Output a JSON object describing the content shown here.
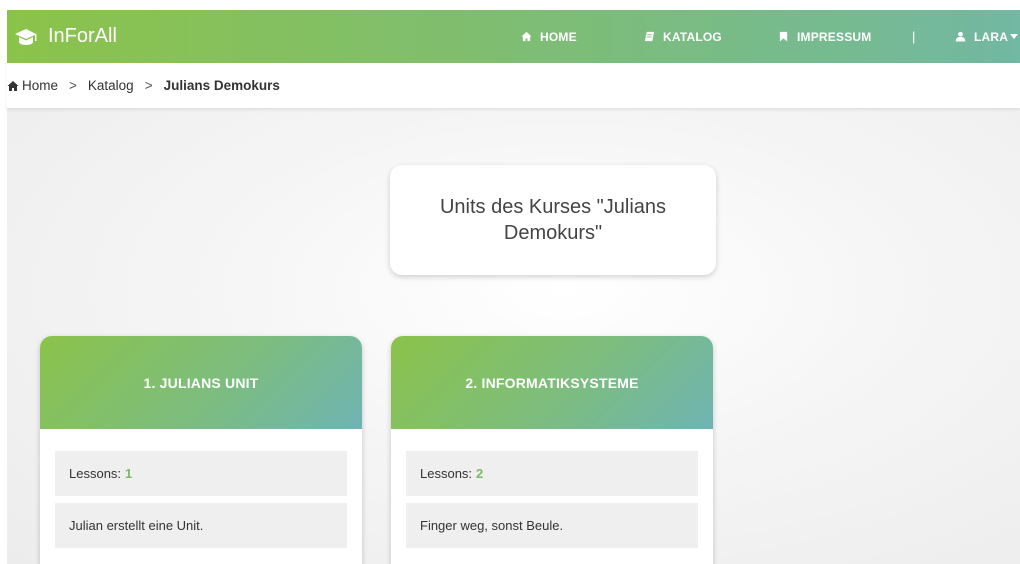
{
  "navbar": {
    "brand": "InForAll",
    "items": [
      {
        "label": "HOME",
        "icon": "home-icon"
      },
      {
        "label": "KATALOG",
        "icon": "book-icon"
      },
      {
        "label": "IMPRESSUM",
        "icon": "bookmark-icon"
      }
    ],
    "separator": "|",
    "user": {
      "label": "LARA",
      "icon": "user-icon"
    }
  },
  "breadcrumb": {
    "items": [
      "Home",
      "Katalog",
      "Julians Demokurs"
    ],
    "separator": ">"
  },
  "main": {
    "title": "Units des Kurses \"Julians Demokurs\"",
    "units": [
      {
        "title": "1. JULIANS UNIT",
        "lessons_label": "Lessons:",
        "lessons_count": "1",
        "description": "Julian erstellt eine Unit."
      },
      {
        "title": "2. INFORMATIKSYSTEME",
        "lessons_label": "Lessons:",
        "lessons_count": "2",
        "description": "Finger weg, sonst Beule."
      }
    ]
  },
  "colors": {
    "accent_green": "#8bc34a",
    "accent_teal": "#6fb4b4",
    "count_green": "#7bb867"
  }
}
